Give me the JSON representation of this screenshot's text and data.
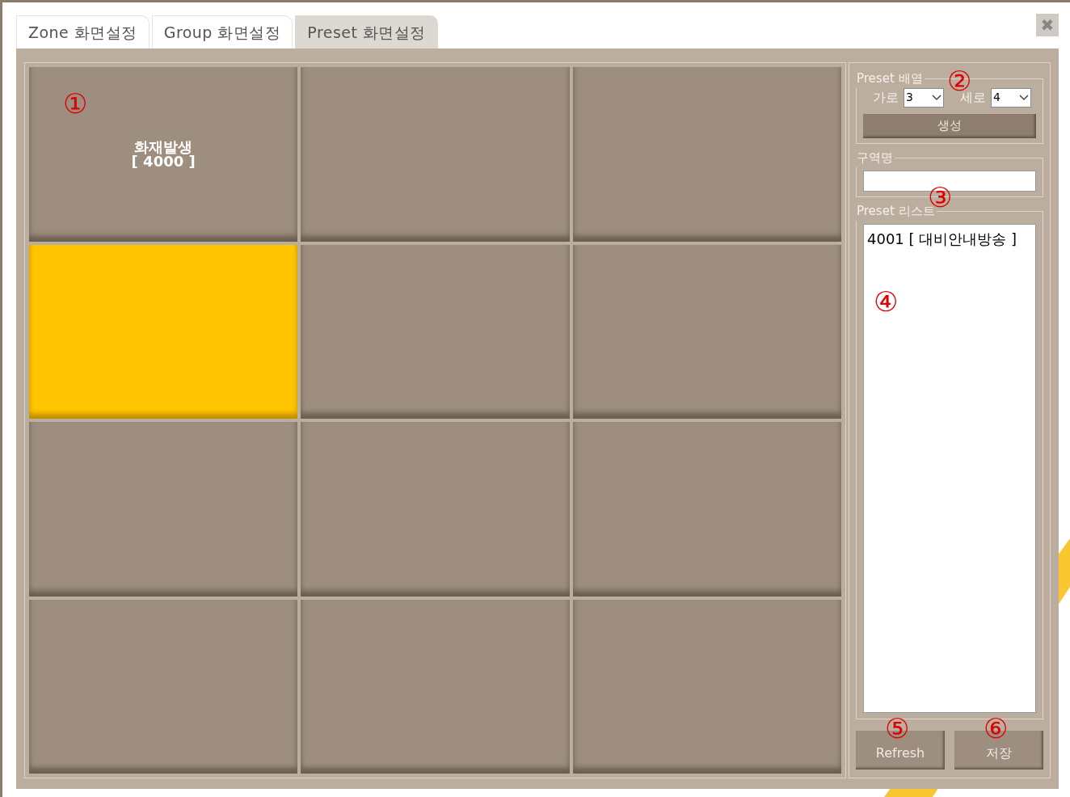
{
  "tabs": [
    {
      "label": "Zone 화면설정",
      "selected": false
    },
    {
      "label": "Group 화면설정",
      "selected": false
    },
    {
      "label": "Preset 화면설정",
      "selected": true
    }
  ],
  "close": "✖",
  "tiles": [
    {
      "title": "화재발생",
      "code": "[ 4000 ]",
      "selected": false,
      "callout": "①"
    },
    {
      "selected": false
    },
    {
      "selected": false
    },
    {
      "selected": true
    },
    {
      "selected": false
    },
    {
      "selected": false
    },
    {
      "selected": false
    },
    {
      "selected": false
    },
    {
      "selected": false
    },
    {
      "selected": false
    },
    {
      "selected": false
    },
    {
      "selected": false
    }
  ],
  "preset_layout": {
    "legend": "Preset 배열",
    "callout": "②",
    "columns_label": "가로",
    "columns_value": "3",
    "rows_label": "세로",
    "rows_value": "4",
    "create_button": "생성"
  },
  "zone_name": {
    "legend": "구역명",
    "callout": "③"
  },
  "preset_list": {
    "legend": "Preset 리스트",
    "callout": "④",
    "items": [
      "4001 [ 대비안내방송 ]"
    ]
  },
  "buttons": [
    {
      "label": "Refresh",
      "callout": "⑤"
    },
    {
      "label": "저장",
      "callout": "⑥"
    }
  ]
}
